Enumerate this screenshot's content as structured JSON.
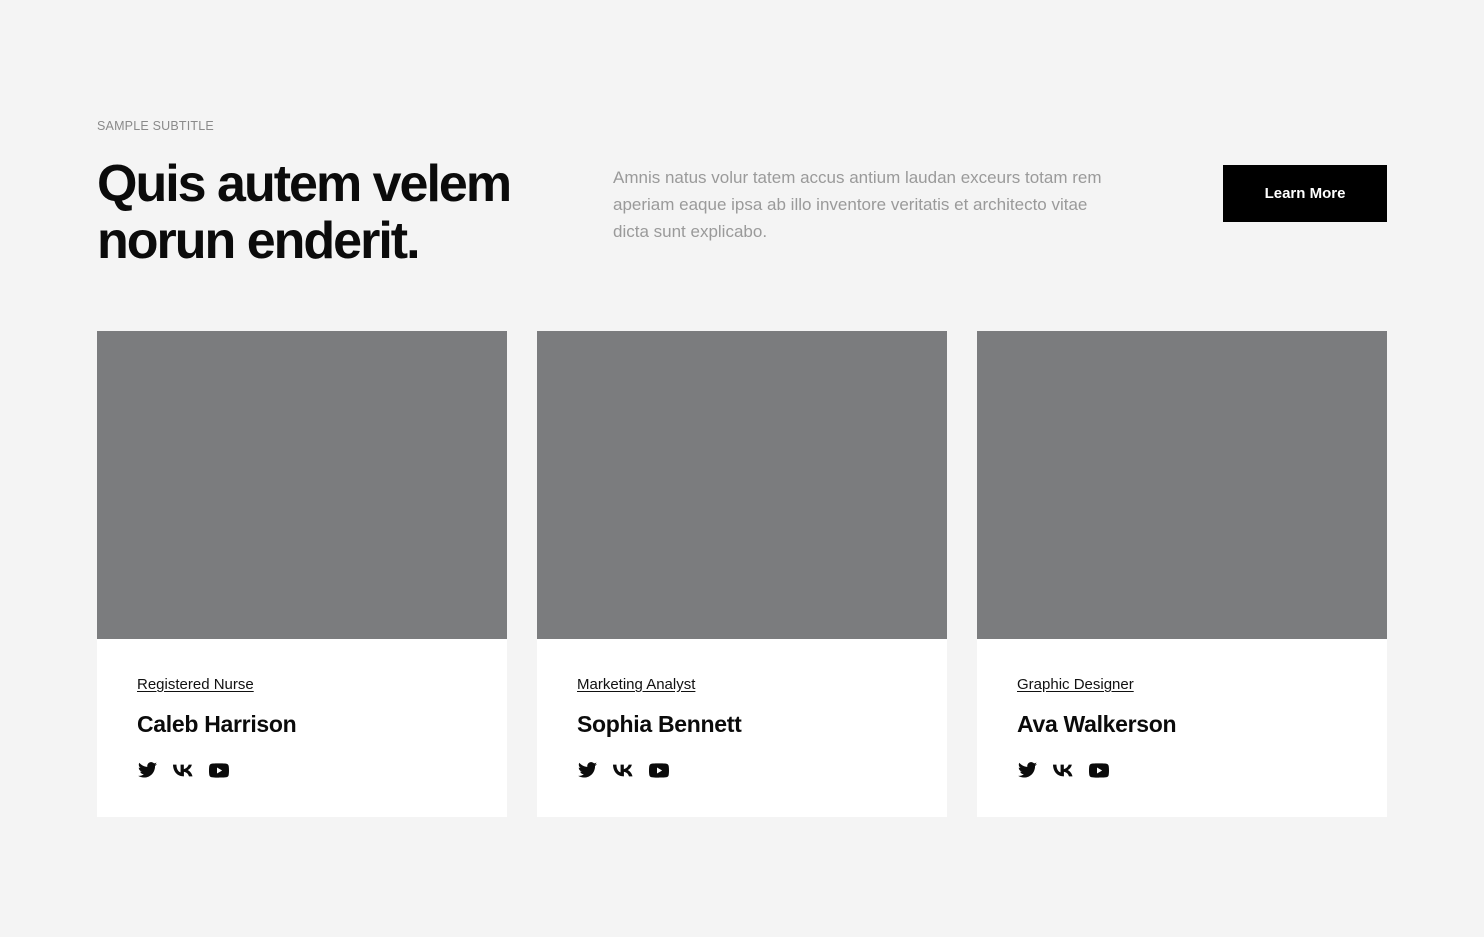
{
  "header": {
    "subtitle": "SAMPLE SUBTITLE",
    "title_line1": "Quis autem velem",
    "title_line2": "norun enderit.",
    "intro": "Amnis natus volur tatem accus antium laudan exceurs totam rem aperiam eaque ipsa ab illo inventore veritatis et architecto vitae dicta sunt explicabo.",
    "cta_label": "Learn More"
  },
  "team": [
    {
      "role": "Registered Nurse",
      "name": "Caleb Harrison",
      "socials": [
        "twitter-icon",
        "vk-icon",
        "youtube-icon"
      ]
    },
    {
      "role": "Marketing Analyst",
      "name": "Sophia Bennett",
      "socials": [
        "twitter-icon",
        "vk-icon",
        "youtube-icon"
      ]
    },
    {
      "role": "Graphic Designer",
      "name": "Ava Walkerson",
      "socials": [
        "twitter-icon",
        "vk-icon",
        "youtube-icon"
      ]
    }
  ],
  "colors": {
    "background": "#f4f4f4",
    "photo_placeholder": "#7b7c7e",
    "card": "#ffffff",
    "button": "#000000",
    "muted_text": "#9a9a9a"
  }
}
